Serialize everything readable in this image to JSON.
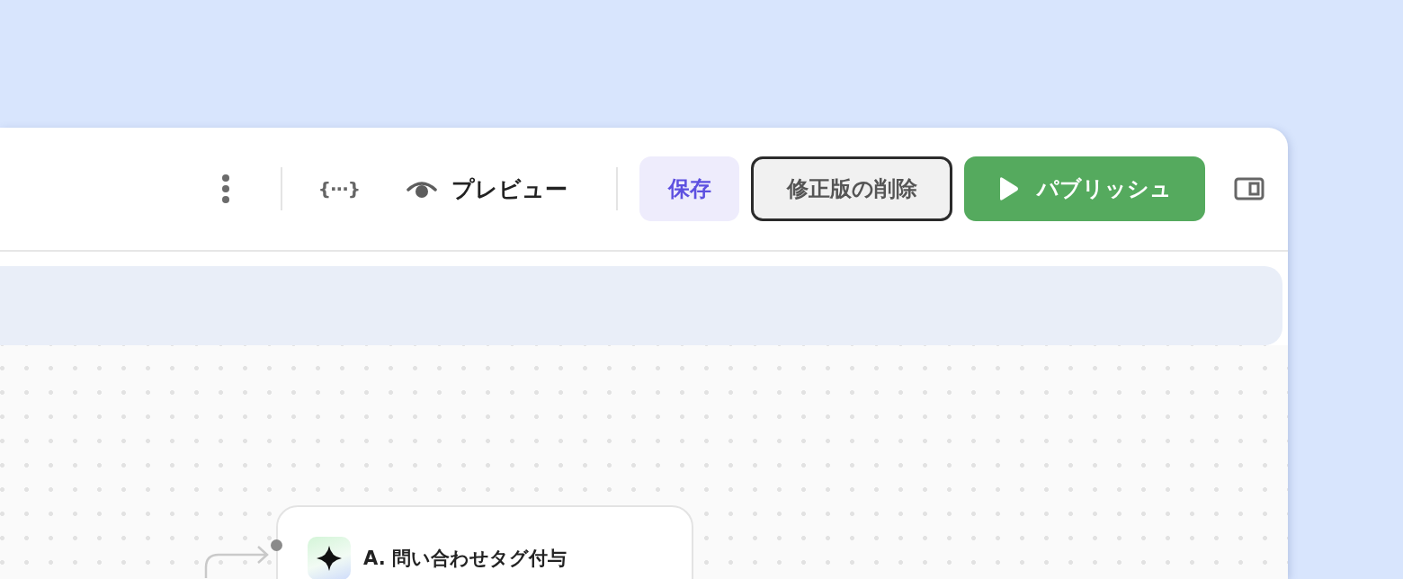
{
  "toolbar": {
    "variables_label": "{···}",
    "preview": {
      "label": "プレビュー"
    },
    "buttons": [
      {
        "kind": "save",
        "label": "保存",
        "focused": false
      },
      {
        "kind": "delete",
        "label": "修正版の削除",
        "focused": true
      },
      {
        "kind": "publish",
        "label": "パブリッシュ",
        "focused": false
      }
    ]
  },
  "canvas": {
    "nodes": [
      {
        "title": "A. 問い合わせタグ付与"
      }
    ]
  }
}
